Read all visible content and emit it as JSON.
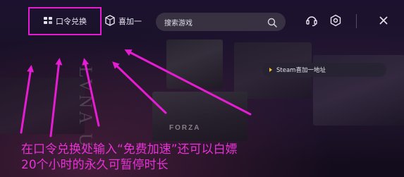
{
  "nav": {
    "redeem_label": "口令兑换",
    "gift_label": "喜加一"
  },
  "search": {
    "placeholder": "搜索游戏"
  },
  "promo": {
    "steam_gift_label": "Steam喜加一地址"
  },
  "background": {
    "forza_text": "FORZA",
    "vertical_text": "LVNA U"
  },
  "caption": {
    "line1": "在口令兑换处输入“免费加速”还可以白嫖",
    "line2": "20个小时的永久可暂停时长"
  },
  "icons": {
    "redeem": "ticket-icon",
    "gift": "gift-box-icon",
    "search": "search-icon",
    "support": "headset-icon",
    "settings": "hexagon-gear-icon",
    "close": "close-icon"
  },
  "colors": {
    "highlight": "#e61cd3",
    "caption": "#e832d6",
    "play_marker": "#f0c030"
  }
}
